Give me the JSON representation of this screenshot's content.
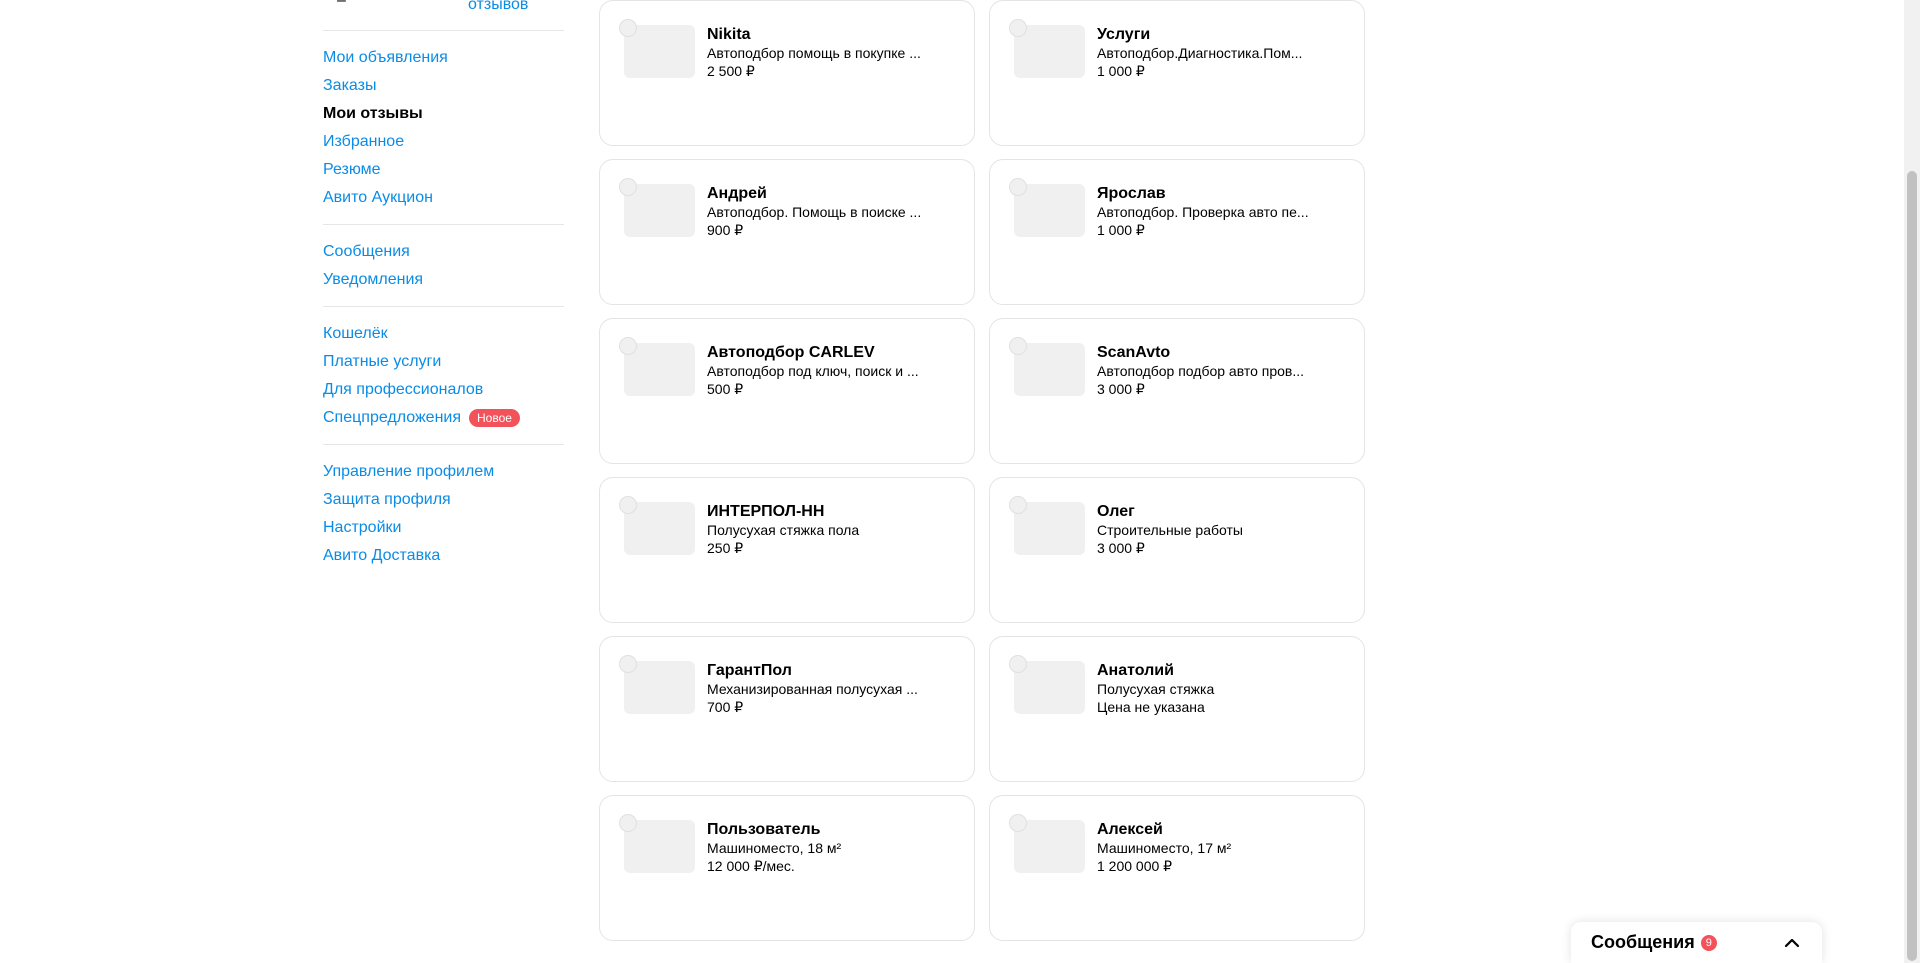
{
  "sidebar": {
    "rating_mark": "–",
    "reviews_link": "отзывов",
    "groups": [
      [
        {
          "label": "Мои объявления",
          "active": false
        },
        {
          "label": "Заказы",
          "active": false
        },
        {
          "label": "Мои отзывы",
          "active": true
        },
        {
          "label": "Избранное",
          "active": false
        },
        {
          "label": "Резюме",
          "active": false
        },
        {
          "label": "Авито Аукцион",
          "active": false
        }
      ],
      [
        {
          "label": "Сообщения",
          "active": false
        },
        {
          "label": "Уведомления",
          "active": false
        }
      ],
      [
        {
          "label": "Кошелёк",
          "active": false
        },
        {
          "label": "Платные услуги",
          "active": false
        },
        {
          "label": "Для профессионалов",
          "active": false
        },
        {
          "label": "Спецпредложения",
          "active": false,
          "badge": "Новое"
        }
      ],
      [
        {
          "label": "Управление профилем",
          "active": false
        },
        {
          "label": "Защита профиля",
          "active": false
        },
        {
          "label": "Настройки",
          "active": false
        },
        {
          "label": "Авито Доставка",
          "active": false
        }
      ]
    ]
  },
  "cards": [
    {
      "name": "Nikita",
      "desc": "Автоподбор помощь в покупке ...",
      "price": "2 500 ₽"
    },
    {
      "name": "Услуги",
      "desc": "Автоподбор.Диагностика.Пом...",
      "price": "1 000 ₽"
    },
    {
      "name": "Андрей",
      "desc": "Автоподбор. Помощь в поиске ...",
      "price": "900 ₽"
    },
    {
      "name": "Ярослав",
      "desc": "Автоподбор. Проверка авто пе...",
      "price": "1 000 ₽"
    },
    {
      "name": "Автоподбор CARLEV",
      "desc": "Автоподбор под ключ, поиск и ...",
      "price": "500 ₽"
    },
    {
      "name": "ScanAvto",
      "desc": "Автоподбор подбор авто пров...",
      "price": "3 000 ₽"
    },
    {
      "name": "ИНТЕРПОЛ-НН",
      "desc": "Полусухая стяжка пола",
      "price": "250 ₽"
    },
    {
      "name": "Олег",
      "desc": "Строительные работы",
      "price": "3 000 ₽"
    },
    {
      "name": "ГарантПол",
      "desc": "Механизированная полусухая ...",
      "price": "700 ₽"
    },
    {
      "name": "Анатолий",
      "desc": "Полусухая стяжка",
      "price": "Цена не указана"
    },
    {
      "name": "Пользователь",
      "desc": "Машиноместо, 18 м²",
      "price": "12 000 ₽/мес."
    },
    {
      "name": "Алексей",
      "desc": "Машиноместо, 17 м²",
      "price": "1 200 000 ₽"
    }
  ],
  "messenger": {
    "title": "Сообщения",
    "count": "9",
    "chevron_icon": "chevron-up-icon"
  },
  "colors": {
    "link": "#0a8ce6",
    "badge": "#f2525a",
    "border": "#e4e4e4",
    "placeholder": "#f0f0f0"
  }
}
